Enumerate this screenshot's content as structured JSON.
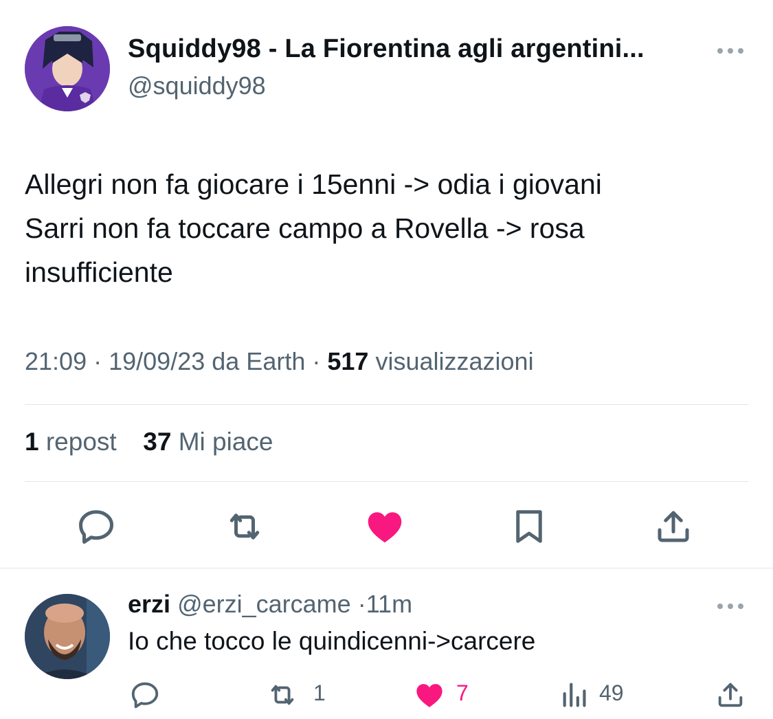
{
  "tweet": {
    "author_name": "Squiddy98 - La Fiorentina agli argentini...",
    "author_handle": "@squiddy98",
    "text_lines": [
      "Allegri non fa giocare i 15enni -> odia i giovani",
      "Sarri non fa toccare campo a Rovella -> rosa",
      "insufficiente"
    ],
    "time": "21:09",
    "date": "19/09/23",
    "source": "da Earth",
    "views_count": "517",
    "views_label": "visualizzazioni",
    "reposts_count": "1",
    "reposts_label": "repost",
    "likes_count": "37",
    "likes_label": "Mi piace",
    "liked": true
  },
  "reply": {
    "author_name": "erzi",
    "author_handle": "@erzi_carcame",
    "time": "11m",
    "text": "Io che tocco le quindicenni->carcere",
    "reposts": "1",
    "likes": "7",
    "views": "49"
  },
  "colors": {
    "like": "#f91880",
    "muted": "#536471",
    "text": "#0f1419"
  },
  "icons": [
    "reply-icon",
    "repost-icon",
    "like-icon",
    "bookmark-icon",
    "share-icon",
    "views-icon",
    "more-icon"
  ]
}
